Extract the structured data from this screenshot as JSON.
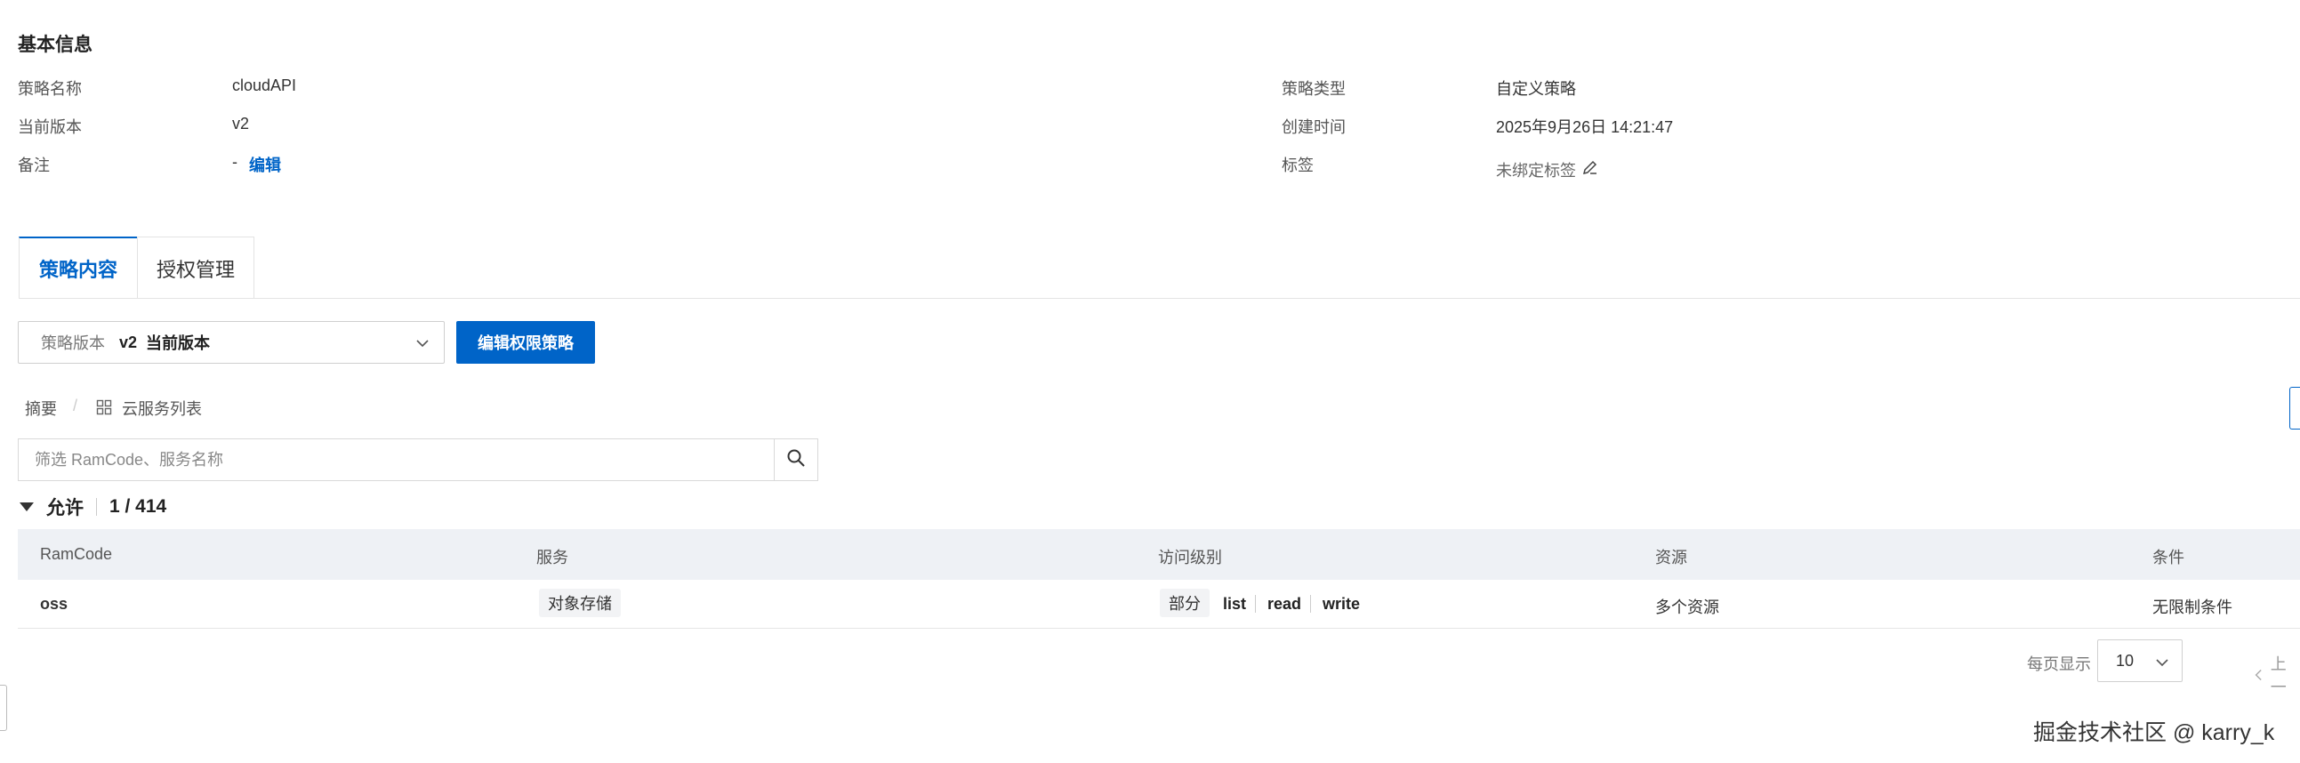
{
  "basic_info": {
    "title": "基本信息",
    "left": [
      {
        "label": "策略名称",
        "value": "cloudAPI"
      },
      {
        "label": "当前版本",
        "value": "v2"
      },
      {
        "label": "备注",
        "value": "-",
        "link": "编辑"
      }
    ],
    "right": [
      {
        "label": "策略类型",
        "value": "自定义策略"
      },
      {
        "label": "创建时间",
        "value": "2025年9月26日 14:21:47"
      },
      {
        "label": "标签",
        "value": "未绑定标签"
      }
    ]
  },
  "tabs": [
    {
      "label": "策略内容",
      "active": true
    },
    {
      "label": "授权管理",
      "active": false
    }
  ],
  "version_select": {
    "label": "策略版本",
    "value": "v2",
    "suffix": "当前版本"
  },
  "edit_button": "编辑权限策略",
  "breadcrumb": {
    "summary": "摘要",
    "separator": "/",
    "service_list": "云服务列表"
  },
  "search": {
    "placeholder": "筛选 RamCode、服务名称",
    "value": ""
  },
  "allow": {
    "label": "允许",
    "count": "1 / 414"
  },
  "table": {
    "columns": [
      "RamCode",
      "服务",
      "访问级别",
      "资源",
      "条件"
    ],
    "rows": [
      {
        "ramcode": "oss",
        "service": "对象存储",
        "level_tag": "部分",
        "levels": [
          "list",
          "read",
          "write"
        ],
        "resource": "多个资源",
        "condition": "无限制条件"
      }
    ]
  },
  "pagination": {
    "label": "每页显示",
    "page_size": "10",
    "prev": "上一"
  },
  "watermark": "掘金技术社区 @ karry_k",
  "colors": {
    "primary": "#0064c8",
    "header_bg": "#eef1f5"
  }
}
